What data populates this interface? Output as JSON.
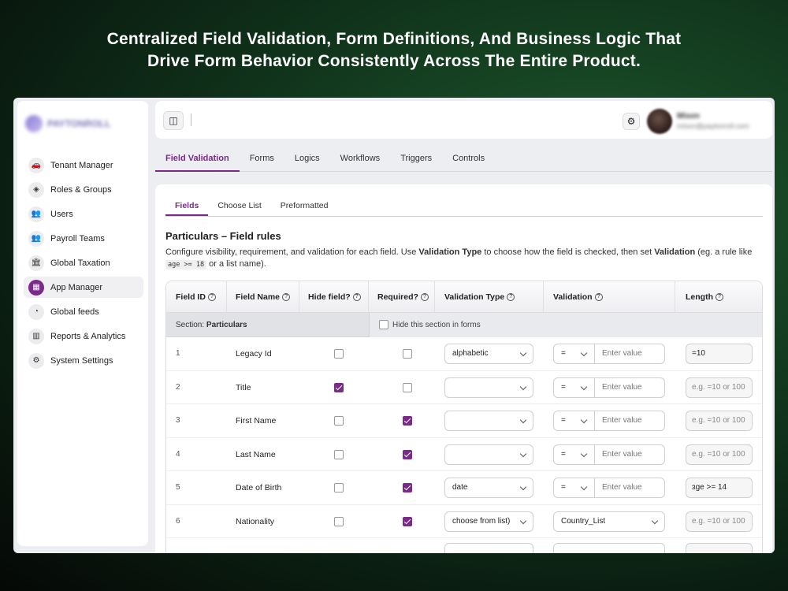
{
  "headline": {
    "line1": "Centralized Field Validation, Form Definitions, And Business Logic That",
    "line2": "Drive Form Behavior Consistently Across The Entire Product."
  },
  "sidebar": {
    "logo_text": "PAYTONROLL",
    "items": [
      {
        "label": "Tenant Manager",
        "icon": "car-icon",
        "glyph": "🚗",
        "active": false
      },
      {
        "label": "Roles & Groups",
        "icon": "shield-icon",
        "glyph": "◈",
        "active": false
      },
      {
        "label": "Users",
        "icon": "users-icon",
        "glyph": "👥",
        "active": false
      },
      {
        "label": "Payroll Teams",
        "icon": "team-icon",
        "glyph": "👥",
        "active": false
      },
      {
        "label": "Global Taxation",
        "icon": "bank-icon",
        "glyph": "🏛",
        "active": false
      },
      {
        "label": "App Manager",
        "icon": "grid-icon",
        "glyph": "▦",
        "active": true
      },
      {
        "label": "Global feeds",
        "icon": "rss-icon",
        "glyph": "◔",
        "active": false
      },
      {
        "label": "Reports & Analytics",
        "icon": "chart-icon",
        "glyph": "▥",
        "active": false
      },
      {
        "label": "System Settings",
        "icon": "gear-icon",
        "glyph": "⚙",
        "active": false
      }
    ]
  },
  "topbar": {
    "user_name": "Mison",
    "user_email": "mison@paytonroll.com"
  },
  "main_tabs": [
    "Field Validation",
    "Forms",
    "Logics",
    "Workflows",
    "Triggers",
    "Controls"
  ],
  "sub_tabs": [
    "Fields",
    "Choose List",
    "Preformatted"
  ],
  "section": {
    "title": "Particulars – Field rules",
    "desc_1": "Configure visibility, requirement, and validation for each field. Use ",
    "desc_b1": "Validation Type",
    "desc_2": " to choose how the field is checked, then set ",
    "desc_b2": "Validation",
    "desc_3": " (eg. a rule like",
    "desc_code": "age >= 18",
    "desc_4": " or a list name)."
  },
  "table": {
    "headers": {
      "field_id": "Field ID",
      "field_name": "Field Name",
      "hide": "Hide field?",
      "required": "Required?",
      "validation_type": "Validation Type",
      "validation": "Validation",
      "length": "Length"
    },
    "section_row": {
      "prefix": "Section:",
      "name": "Particulars",
      "hide_label": "Hide this section in forms"
    },
    "rows": [
      {
        "id": "1",
        "name": "Legacy Id",
        "hide": false,
        "required": false,
        "vtype": "alphabetic",
        "op": "=",
        "validation": "Enter value",
        "length": "=10",
        "length_filled": true
      },
      {
        "id": "2",
        "name": "Title",
        "hide": true,
        "required": false,
        "vtype": "",
        "op": "=",
        "validation": "Enter value",
        "length": "e.g. =10 or 100",
        "length_filled": false
      },
      {
        "id": "3",
        "name": "First Name",
        "hide": false,
        "required": true,
        "vtype": "",
        "op": "=",
        "validation": "Enter value",
        "length": "e.g. =10 or 100",
        "length_filled": false
      },
      {
        "id": "4",
        "name": "Last Name",
        "hide": false,
        "required": true,
        "vtype": "",
        "op": "=",
        "validation": "Enter value",
        "length": "e.g. =10 or 100",
        "length_filled": false
      },
      {
        "id": "5",
        "name": "Date of Birth",
        "hide": false,
        "required": true,
        "vtype": "date",
        "op": "=",
        "validation": "Enter value",
        "length": "ɜge >= 14",
        "length_filled": true
      },
      {
        "id": "6",
        "name": "Nationality",
        "hide": false,
        "required": true,
        "vtype": "choose from list)",
        "op": "",
        "validation": "Country_List",
        "length": "e.g. =10 or 100",
        "length_filled": false
      }
    ]
  }
}
